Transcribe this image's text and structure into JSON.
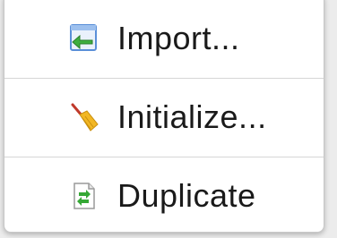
{
  "menu": {
    "items": [
      {
        "label": "Import...",
        "icon": "import-icon"
      },
      {
        "label": "Initialize...",
        "icon": "broom-icon"
      },
      {
        "label": "Duplicate",
        "icon": "duplicate-icon"
      }
    ]
  },
  "colors": {
    "import_icon_blue": "#5a8fd8",
    "import_icon_green": "#3fae3f",
    "broom_handle": "#c0392b",
    "broom_bristles": "#f2b724",
    "duplicate_green": "#35a835"
  }
}
